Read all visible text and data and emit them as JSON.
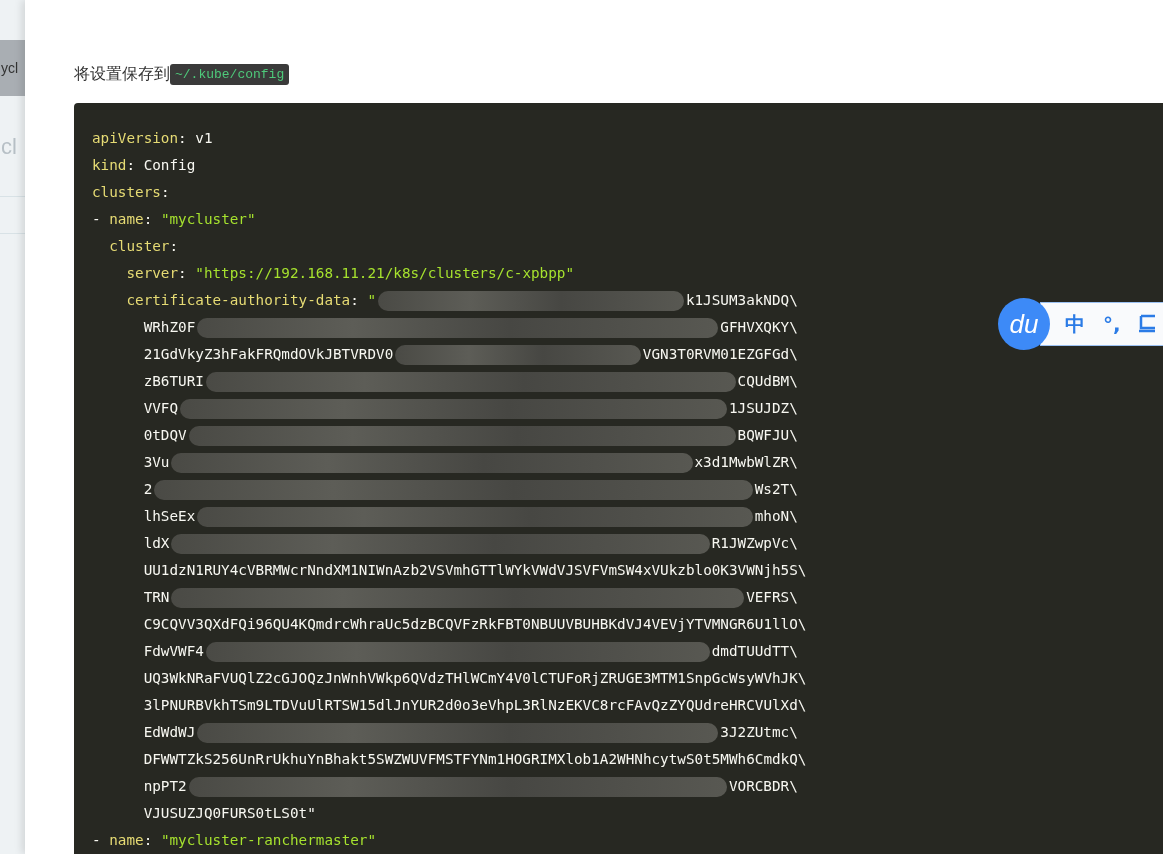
{
  "sidebar": {
    "labels": [
      "ycl",
      "cl"
    ]
  },
  "intro": {
    "text": "将设置保存到",
    "path": "~/.kube/config"
  },
  "code_lines": [
    {
      "redacted": false,
      "tokens": [
        {
          "kind": "key",
          "text": "apiVersion"
        },
        {
          "kind": "plain",
          "text": ": v1"
        }
      ]
    },
    {
      "redacted": false,
      "tokens": [
        {
          "kind": "key",
          "text": "kind"
        },
        {
          "kind": "plain",
          "text": ": Config"
        }
      ]
    },
    {
      "redacted": false,
      "tokens": [
        {
          "kind": "key",
          "text": "clusters"
        },
        {
          "kind": "plain",
          "text": ":"
        }
      ]
    },
    {
      "redacted": false,
      "tokens": [
        {
          "kind": "plain",
          "text": "- "
        },
        {
          "kind": "key",
          "text": "name"
        },
        {
          "kind": "plain",
          "text": ": "
        },
        {
          "kind": "str",
          "text": "\"mycluster\""
        }
      ]
    },
    {
      "redacted": false,
      "tokens": [
        {
          "kind": "key",
          "text": "  cluster"
        },
        {
          "kind": "plain",
          "text": ":"
        }
      ]
    },
    {
      "redacted": false,
      "tokens": [
        {
          "kind": "key",
          "text": "    server"
        },
        {
          "kind": "plain",
          "text": ": "
        },
        {
          "kind": "str",
          "text": "\"https://192.168.11.21/k8s/clusters/c-xpbpp\""
        }
      ]
    },
    {
      "redacted": true,
      "tokens": [
        {
          "kind": "key",
          "text": "    certificate-authority-data"
        },
        {
          "kind": "plain",
          "text": ": "
        },
        {
          "kind": "str",
          "text": "\""
        }
      ],
      "tail": "k1JSUM3akNDQ\\"
    },
    {
      "redacted": true,
      "tokens": [
        {
          "kind": "plain",
          "text": "      WRhZ0F"
        }
      ],
      "tail": "GFHVXQKY\\"
    },
    {
      "redacted": true,
      "tokens": [
        {
          "kind": "plain",
          "text": "      21GdVkyZ3hFakFRQmdOVkJBTVRDV0"
        }
      ],
      "tail": "VGN3T0RVM01EZGFGd\\"
    },
    {
      "redacted": true,
      "tokens": [
        {
          "kind": "plain",
          "text": "      zB6TURI"
        }
      ],
      "tail": "CQUdBM\\"
    },
    {
      "redacted": true,
      "tokens": [
        {
          "kind": "plain",
          "text": "      VVFQ"
        }
      ],
      "tail": "1JSUJDZ\\"
    },
    {
      "redacted": true,
      "tokens": [
        {
          "kind": "plain",
          "text": "      0tDQV"
        }
      ],
      "tail": "BQWFJU\\"
    },
    {
      "redacted": true,
      "tokens": [
        {
          "kind": "plain",
          "text": "      3Vu"
        }
      ],
      "tail": "x3d1MwbWlZR\\"
    },
    {
      "redacted": true,
      "tokens": [
        {
          "kind": "plain",
          "text": "      2"
        }
      ],
      "tail": "Ws2T\\"
    },
    {
      "redacted": true,
      "tokens": [
        {
          "kind": "plain",
          "text": "      lhSeEx"
        }
      ],
      "tail": "mhoN\\"
    },
    {
      "redacted": true,
      "tokens": [
        {
          "kind": "plain",
          "text": "      ldX"
        }
      ],
      "tail": "R1JWZwpVc\\"
    },
    {
      "redacted": false,
      "tokens": [
        {
          "kind": "plain",
          "text": "      UU1dzN1RUY4cVBRMWcrNndXM1NIWnAzb2VSVmhGTTlWYkVWdVJSVFVmSW4xVUkzblo0K3VWNjh5S\\"
        }
      ]
    },
    {
      "redacted": true,
      "tokens": [
        {
          "kind": "plain",
          "text": "      TRN"
        }
      ],
      "tail": "VEFRS\\"
    },
    {
      "redacted": false,
      "tokens": [
        {
          "kind": "plain",
          "text": "      C9CQVV3QXdFQi96QU4KQmdrcWhraUc5dzBCQVFzRkFBT0NBUUVBUHBKdVJ4VEVjYTVMNGR6U1llO\\"
        }
      ]
    },
    {
      "redacted": true,
      "tokens": [
        {
          "kind": "plain",
          "text": "      FdwVWF4"
        }
      ],
      "tail": "dmdTUUdTT\\"
    },
    {
      "redacted": false,
      "tokens": [
        {
          "kind": "plain",
          "text": "      UQ3WkNRaFVUQlZ2cGJOQzJnWnhVWkp6QVdzTHlWCmY4V0lCTUFoRjZRUGE3MTM1SnpGcWsyWVhJK\\"
        }
      ]
    },
    {
      "redacted": false,
      "tokens": [
        {
          "kind": "plain",
          "text": "      3lPNURBVkhTSm9LTDVuUlRTSW15dlJnYUR2d0o3eVhpL3RlNzEKVC8rcFAvQzZYQUdreHRCVUlXd\\"
        }
      ]
    },
    {
      "redacted": true,
      "tokens": [
        {
          "kind": "plain",
          "text": "      EdWdWJ"
        }
      ],
      "tail": "3J2ZUtmc\\"
    },
    {
      "redacted": false,
      "tokens": [
        {
          "kind": "plain",
          "text": "      DFWWTZkS256UnRrUkhuYnBhakt5SWZWUVFMSTFYNm1HOGRIMXlob1A2WHNhcytwS0t5MWh6CmdkQ\\"
        }
      ]
    },
    {
      "redacted": true,
      "tokens": [
        {
          "kind": "plain",
          "text": "      npPT2"
        }
      ],
      "tail": "VORCBDR\\"
    },
    {
      "redacted": false,
      "tokens": [
        {
          "kind": "plain",
          "text": "      VJUSUZJQ0FURS0tLS0t\""
        }
      ]
    },
    {
      "redacted": false,
      "tokens": [
        {
          "kind": "plain",
          "text": "- "
        },
        {
          "kind": "key",
          "text": "name"
        },
        {
          "kind": "plain",
          "text": ": "
        },
        {
          "kind": "str",
          "text": "\"mycluster-ranchermaster\""
        }
      ]
    }
  ],
  "ime_toolbar": {
    "logo": "du",
    "mode": "中",
    "punctuation": "°,"
  }
}
